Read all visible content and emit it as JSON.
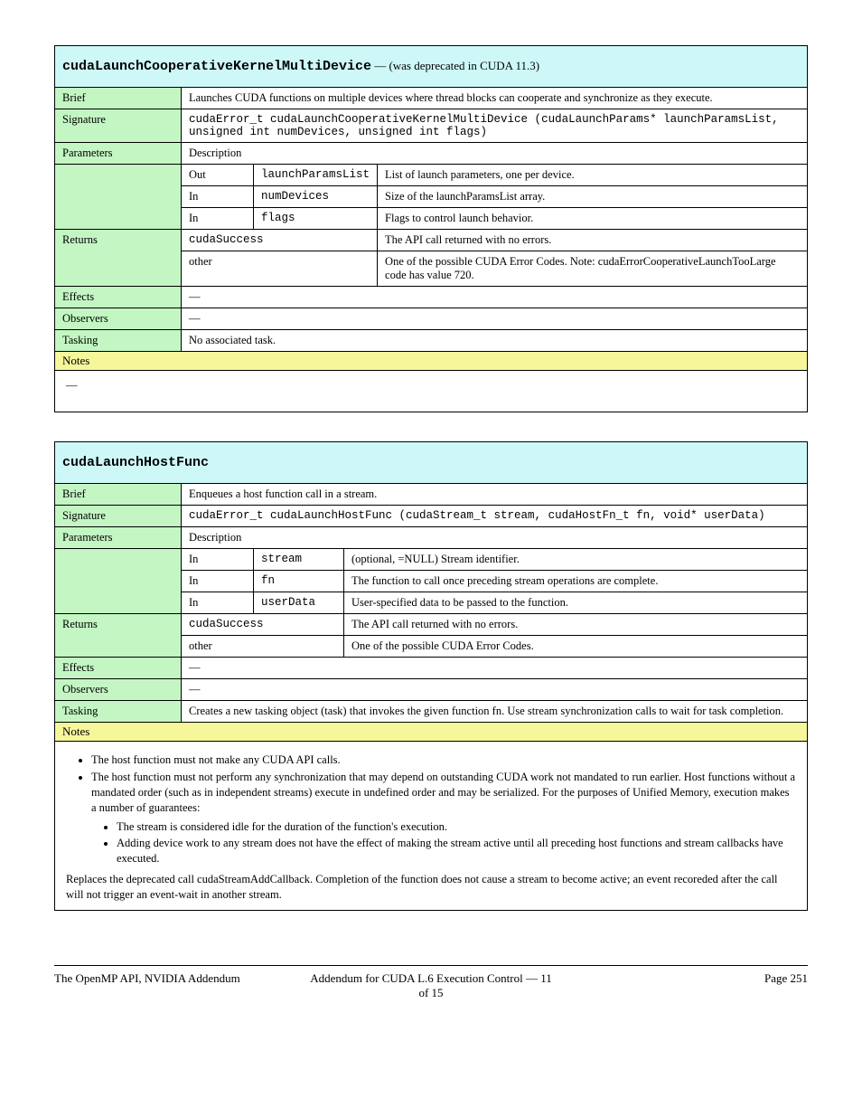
{
  "table1": {
    "header_name": "cudaLaunchCooperativeKernelMultiDevice",
    "header_desc": "— (was deprecated in CUDA 11.3)",
    "brief_label": "Brief",
    "brief_value": "Launches CUDA functions on multiple devices where thread blocks can cooperate and synchronize as they execute.",
    "signature_label": "Signature",
    "signature_value": "cudaError_t cudaLaunchCooperativeKernelMultiDevice (cudaLaunchParams* launchParamsList, unsigned int numDevices, unsigned int flags)",
    "parameters_label": "Parameters",
    "description_label": "Description",
    "params": [
      {
        "dir": "Out",
        "name": "launchParamsList",
        "desc": "List of launch parameters, one per device."
      },
      {
        "dir": "In",
        "name": "numDevices",
        "desc": "Size of the launchParamsList array."
      },
      {
        "dir": "In",
        "name": "flags",
        "desc": "Flags to control launch behavior."
      }
    ],
    "returns_label": "Returns",
    "returns": [
      {
        "name": "cudaSuccess",
        "desc": "The API call returned with no errors."
      },
      {
        "name": "other",
        "desc": "One of the possible CUDA Error Codes. Note: cudaErrorCooperativeLaunchTooLarge code has value 720."
      }
    ],
    "effects_label": "Effects",
    "effects_value": "—",
    "observers_label": "Observers",
    "observers_value": "—",
    "tasking_label": "Tasking",
    "tasking_value": "No associated task.",
    "notes_label": "Notes",
    "notes_value": "—"
  },
  "table2": {
    "header_name": "cudaLaunchHostFunc",
    "brief_label": "Brief",
    "brief_value": "Enqueues a host function call in a stream.",
    "signature_label": "Signature",
    "signature_value": "cudaError_t cudaLaunchHostFunc (cudaStream_t stream, cudaHostFn_t fn, void* userData)",
    "parameters_label": "Parameters",
    "description_label": "Description",
    "params": [
      {
        "dir": "In",
        "name": "stream",
        "desc": "(optional, =NULL) Stream identifier."
      },
      {
        "dir": "In",
        "name": "fn",
        "desc": "The function to call once preceding stream operations are complete."
      },
      {
        "dir": "In",
        "name": "userData",
        "desc": "User-specified data to be passed to the function."
      }
    ],
    "returns_label": "Returns",
    "returns": [
      {
        "name": "cudaSuccess",
        "desc": "The API call returned with no errors."
      },
      {
        "name": "other",
        "desc": "One of the possible CUDA Error Codes."
      }
    ],
    "effects_label": "Effects",
    "effects_value": "—",
    "observers_label": "Observers",
    "observers_value": "—",
    "tasking_label": "Tasking",
    "tasking_value": "Creates a new tasking object (task) that invokes the given function fn. Use stream synchronization calls to wait for task completion.",
    "notes_label": "Notes",
    "notes_ul1": [
      "The host function must not make any CUDA API calls.",
      "The host function must not perform any synchronization that may depend on outstanding CUDA work not mandated to run earlier. Host functions without a mandated order (such as in independent streams) execute in undefined order and may be serialized. For the purposes of Unified Memory, execution makes a number of guarantees:"
    ],
    "notes_ul2": [
      "The stream is considered idle for the duration of the function's execution.",
      "Adding device work to any stream does not have the effect of making the stream active until all preceding host functions and stream callbacks have executed."
    ],
    "notes_trailer": "Replaces the deprecated call cudaStreamAddCallback. Completion of the function does not cause a stream to become active; an event recoreded after the call will not trigger an event-wait in another stream."
  },
  "footer": {
    "left": "The OpenMP API, NVIDIA Addendum",
    "center_prefix": "Addendum for CUDA ",
    "center_link": "L.6",
    "center_suffix": " Execution Control — 11 of 15",
    "right": "Page 251"
  }
}
